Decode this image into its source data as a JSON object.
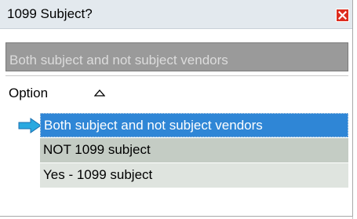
{
  "dialog": {
    "title": "1099 Subject?"
  },
  "search": {
    "value": "Both subject and not subject vendors"
  },
  "list": {
    "column_header": "Option",
    "rows": [
      {
        "label": "Both subject and not subject vendors",
        "selected": true
      },
      {
        "label": "NOT 1099 subject",
        "selected": false
      },
      {
        "label": "Yes - 1099 subject",
        "selected": false
      }
    ]
  },
  "colors": {
    "selection": "#2f86d6",
    "close": "#dd2d1f",
    "indicator_arrow": "#2aa9e0"
  },
  "icons": {
    "close": "close-icon",
    "sort": "sort-ascending-icon",
    "row_indicator": "arrow-right-icon"
  }
}
